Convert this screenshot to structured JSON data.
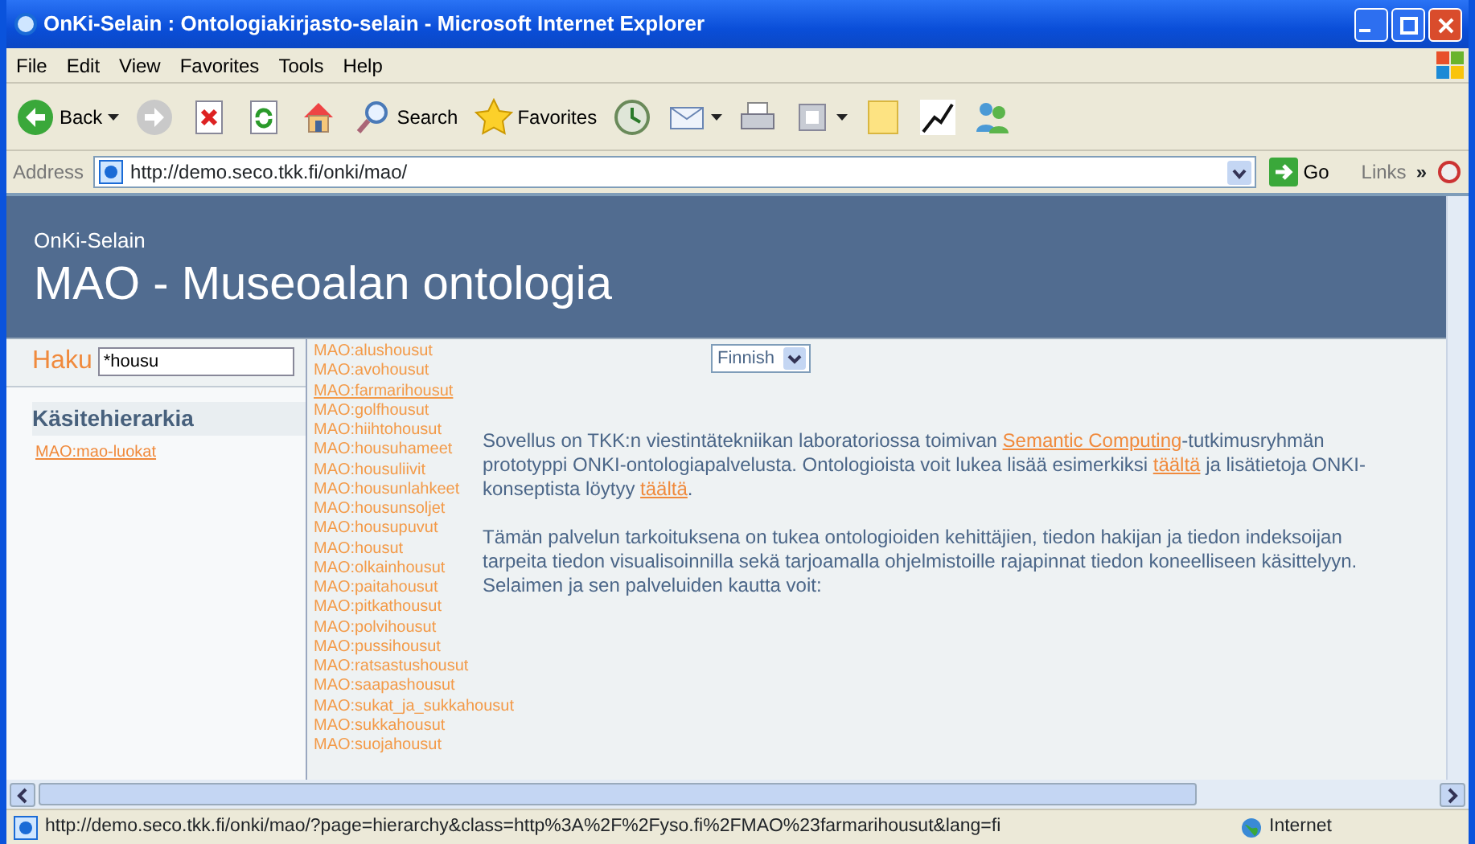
{
  "window": {
    "title": "OnKi-Selain : Ontologiakirjasto-selain - Microsoft Internet Explorer"
  },
  "menu": [
    "File",
    "Edit",
    "View",
    "Favorites",
    "Tools",
    "Help"
  ],
  "toolbar": [
    {
      "kind": "back",
      "label": "Back"
    },
    {
      "kind": "forward"
    },
    {
      "kind": "stop"
    },
    {
      "kind": "refresh"
    },
    {
      "kind": "home"
    },
    {
      "kind": "search",
      "label": "Search"
    },
    {
      "kind": "favorites",
      "label": "Favorites"
    },
    {
      "kind": "history"
    },
    {
      "kind": "mail"
    },
    {
      "kind": "print"
    },
    {
      "kind": "edit"
    },
    {
      "kind": "note"
    },
    {
      "kind": "chart"
    },
    {
      "kind": "people"
    }
  ],
  "address": {
    "label": "Address",
    "value": "http://demo.seco.tkk.fi/onki/mao/",
    "go": "Go",
    "links": "Links",
    "chevron": "»"
  },
  "page": {
    "subtitle": "OnKi-Selain",
    "title": "MAO - Museoalan ontologia",
    "search": {
      "label": "Haku",
      "value": "*housu"
    },
    "hierarchy": {
      "heading": "Käsitehierarkia",
      "items": [
        "MAO:mao-luokat"
      ]
    },
    "results": [
      {
        "text": "MAO:alushousut",
        "hovered": false
      },
      {
        "text": "MAO:avohousut",
        "hovered": false
      },
      {
        "text": "MAO:farmarihousut",
        "hovered": true
      },
      {
        "text": "MAO:golfhousut",
        "hovered": false
      },
      {
        "text": "MAO:hiihtohousut",
        "hovered": false
      },
      {
        "text": "MAO:housuhameet",
        "hovered": false
      },
      {
        "text": "MAO:housuliivit",
        "hovered": false
      },
      {
        "text": "MAO:housunlahkeet",
        "hovered": false
      },
      {
        "text": "MAO:housunsoljet",
        "hovered": false
      },
      {
        "text": "MAO:housupuvut",
        "hovered": false
      },
      {
        "text": "MAO:housut",
        "hovered": false
      },
      {
        "text": "MAO:olkainhousut",
        "hovered": false
      },
      {
        "text": "MAO:paitahousut",
        "hovered": false
      },
      {
        "text": "MAO:pitkathousut",
        "hovered": false
      },
      {
        "text": "MAO:polvihousut",
        "hovered": false
      },
      {
        "text": "MAO:pussihousut",
        "hovered": false
      },
      {
        "text": "MAO:ratsastushousut",
        "hovered": false
      },
      {
        "text": "MAO:saapashousut",
        "hovered": false
      },
      {
        "text": "MAO:sukat_ja_sukkahousut",
        "hovered": false
      },
      {
        "text": "MAO:sukkahousut",
        "hovered": false
      },
      {
        "text": "MAO:suojahousut",
        "hovered": false
      }
    ],
    "language": "Finnish",
    "paragraphs": [
      [
        {
          "text": "Sovellus on TKK:n viestintätekniikan laboratoriossa toimivan ",
          "link": false
        },
        {
          "text": "Semantic Computing",
          "link": true
        },
        {
          "text": "-tutkimusryhmän prototyppi ONKI-ontologiapalvelusta. Ontologioista voit lukea lisää esimerkiksi ",
          "link": false
        },
        {
          "text": "täältä",
          "link": true
        },
        {
          "text": " ja lisätietoja ONKI-konseptista löytyy ",
          "link": false
        },
        {
          "text": "täältä",
          "link": true
        },
        {
          "text": ".",
          "link": false
        }
      ],
      [
        {
          "text": "Tämän palvelun tarkoituksena on tukea ontologioiden kehittäjien, tiedon hakijan ja tiedon indeksoijan tarpeita tiedon visualisoinnilla sekä tarjoamalla ohjelmistoille rajapinnat tiedon koneelliseen käsittelyyn. Selaimen ja sen palveluiden kautta voit:",
          "link": false
        }
      ]
    ]
  },
  "status": {
    "url": "http://demo.seco.tkk.fi/onki/mao/?page=hierarchy&class=http%3A%2F%2Fyso.fi%2FMAO%23farmarihousut&lang=fi",
    "zone": "Internet"
  }
}
